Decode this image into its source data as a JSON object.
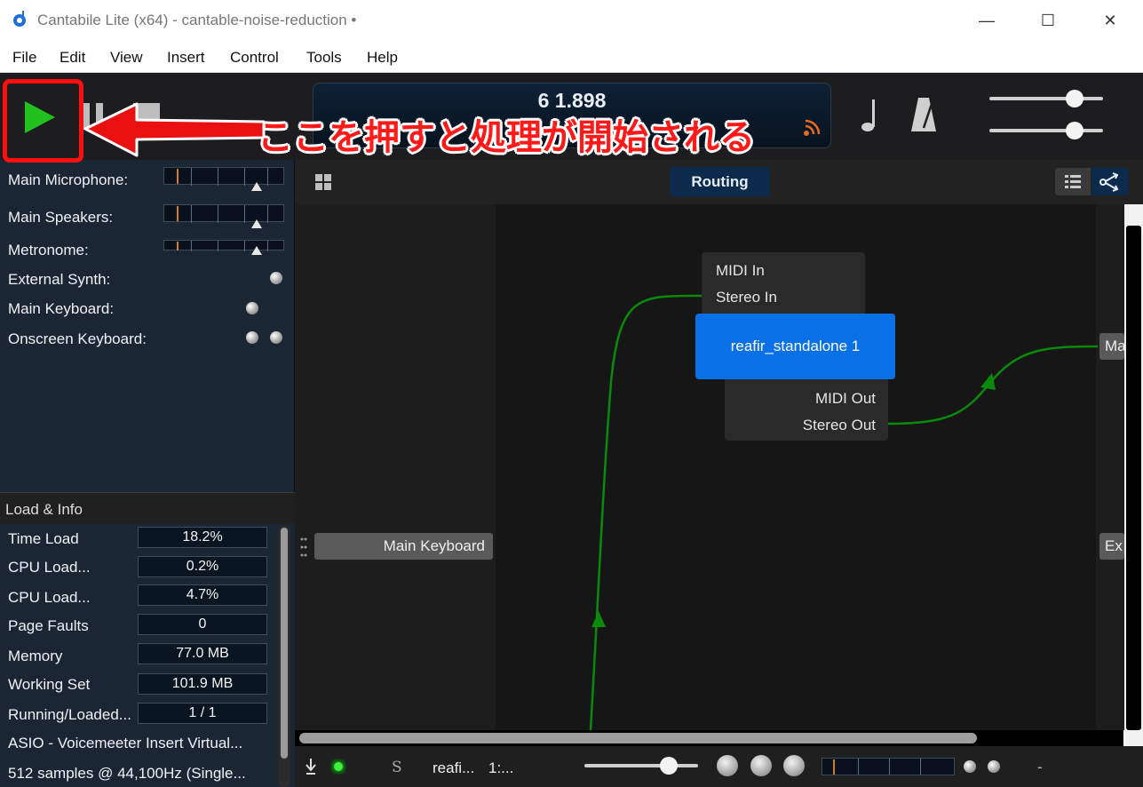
{
  "window": {
    "title": "Cantabile Lite (x64) - cantable-noise-reduction •",
    "minimize_glyph": "—",
    "maximize_glyph": "☐",
    "close_glyph": "✕"
  },
  "menu": [
    "File",
    "Edit",
    "View",
    "Insert",
    "Control",
    "Tools",
    "Help"
  ],
  "transport": {
    "position": "6 1.898",
    "play_icon": "play-icon",
    "pause_icon": "pause-icon",
    "stop_icon": "stop-icon"
  },
  "annotation": {
    "text": "ここを押すと処理が開始される",
    "color": "#ff1a1a"
  },
  "ports": [
    {
      "label": "Main Microphone:",
      "type": "meter"
    },
    {
      "label": "Main Speakers:",
      "type": "meter"
    },
    {
      "label": "Metronome:",
      "type": "meter"
    },
    {
      "label": "External Synth:",
      "type": "led"
    },
    {
      "label": "Main Keyboard:",
      "type": "led"
    },
    {
      "label": "Onscreen Keyboard:",
      "type": "led2"
    }
  ],
  "load_info": {
    "header": "Load & Info",
    "rows": [
      {
        "label": "Time Load",
        "value": "18.2%"
      },
      {
        "label": "CPU Load...",
        "value": "0.2%"
      },
      {
        "label": "CPU Load...",
        "value": "4.7%"
      },
      {
        "label": "Page Faults",
        "value": "0"
      },
      {
        "label": "Memory",
        "value": "77.0 MB"
      },
      {
        "label": "Working Set",
        "value": "101.9 MB"
      },
      {
        "label": "Running/Loaded...",
        "value": "1 / 1"
      }
    ],
    "driver": "ASIO - Voicemeeter Insert Virtual...",
    "format": "512 samples @ 44,100Hz (Single..."
  },
  "routing": {
    "tab_label": "Routing",
    "plugin_name": "reafir_standalone 1",
    "inputs": [
      "MIDI In",
      "Stereo In"
    ],
    "outputs": [
      "MIDI Out",
      "Stereo Out"
    ],
    "left_node": "Main Keyboard",
    "right_node_1": "Ma",
    "right_node_2": "Ex",
    "route_color": "#0a8a0a"
  },
  "statusbar": {
    "solo_label": "S",
    "plugin_short": "reafi...",
    "channel": "1:...",
    "dash": "-"
  },
  "colors": {
    "accent": "#0a70e6",
    "play": "#21c21f"
  }
}
